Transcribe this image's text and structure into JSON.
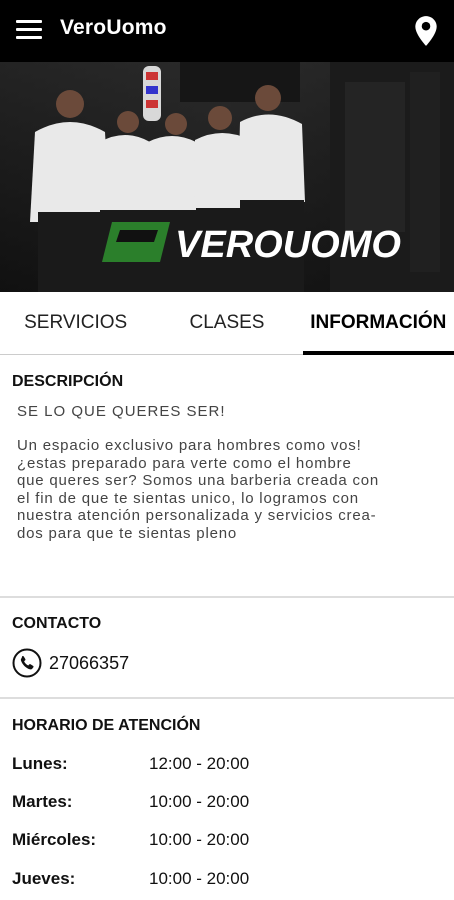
{
  "appbar": {
    "title": "VeroUomo",
    "menu_icon": "hamburger-menu-icon",
    "location_icon": "map-pin-icon"
  },
  "hero": {
    "logo_text": "VEROUOMO"
  },
  "tabs": [
    {
      "label": "SERVICIOS",
      "active": false
    },
    {
      "label": "CLASES",
      "active": false
    },
    {
      "label": "INFORMACIÓN",
      "active": true
    }
  ],
  "description": {
    "title": "DESCRIPCIÓN",
    "headline": "SE LO QUE QUERES SER!",
    "lines": [
      "Un espacio exclusivo para hombres como vos!",
      "¿estas preparado para verte como el hombre",
      "que queres ser? Somos una barberia creada con",
      "el fin de que te sientas unico, lo logramos con",
      "nuestra atención personalizada y servicios crea-",
      "dos para que te sientas pleno"
    ]
  },
  "contact": {
    "title": "CONTACTO",
    "phone_icon": "phone-icon",
    "phone": "27066357"
  },
  "hours": {
    "title": "HORARIO DE ATENCIÓN",
    "rows": [
      {
        "day": "Lunes:",
        "time": "12:00 - 20:00"
      },
      {
        "day": "Martes:",
        "time": "10:00 - 20:00"
      },
      {
        "day": "Miércoles:",
        "time": "10:00 - 20:00"
      },
      {
        "day": "Jueves:",
        "time": "10:00 - 20:00"
      }
    ]
  },
  "colors": {
    "appbar": "#000000",
    "accent_green": "#2e8b2e",
    "text": "#111111"
  }
}
